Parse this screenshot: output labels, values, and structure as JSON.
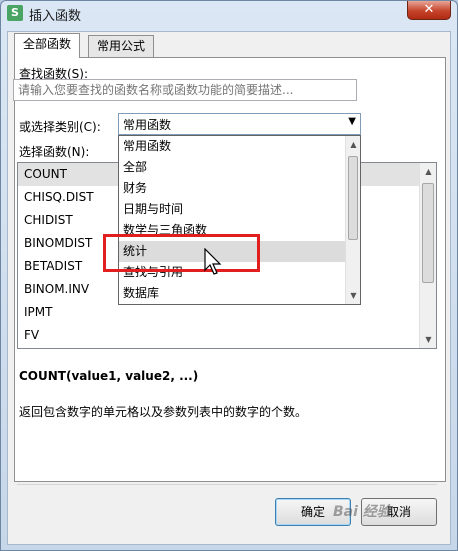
{
  "window": {
    "title": "插入函数",
    "icon_letter": "S",
    "close_glyph": "✕"
  },
  "tabs": [
    {
      "label": "全部函数",
      "active": true
    },
    {
      "label": "常用公式",
      "active": false
    }
  ],
  "search": {
    "label": "查找函数(S):",
    "placeholder": "请输入您要查找的函数名称或函数功能的简要描述..."
  },
  "category": {
    "label": "或选择类别(C):",
    "selected": "常用函数",
    "options": [
      "常用函数",
      "全部",
      "财务",
      "日期与时间",
      "数学与三角函数",
      "统计",
      "查找与引用",
      "数据库"
    ],
    "hovered": "统计"
  },
  "functions": {
    "label": "选择函数(N):",
    "items": [
      "COUNT",
      "CHISQ.DIST",
      "CHIDIST",
      "BINOMDIST",
      "BETADIST",
      "BINOM.INV",
      "IPMT",
      "FV"
    ],
    "selected": "COUNT"
  },
  "detail": {
    "signature": "COUNT(value1, value2, ...)",
    "description": "返回包含数字的单元格以及参数列表中的数字的个数。"
  },
  "buttons": {
    "ok": "确定",
    "cancel": "取消"
  },
  "watermark": "Bai 经验",
  "colors": {
    "highlight": "#e21f1f",
    "close": "#c5442b"
  }
}
